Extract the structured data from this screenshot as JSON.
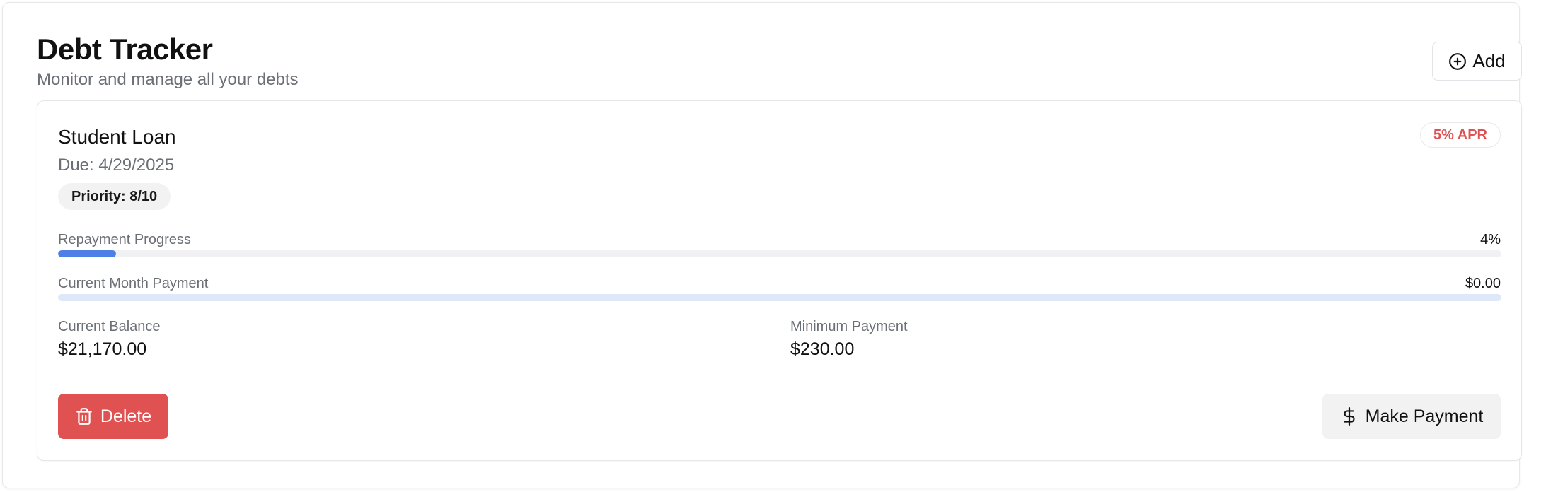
{
  "header": {
    "title": "Debt Tracker",
    "subtitle": "Monitor and manage all your debts",
    "add_label": "Add"
  },
  "debt": {
    "name": "Student Loan",
    "apr_badge": "5% APR",
    "due_date": "Due: 4/29/2025",
    "priority": "Priority: 8/10",
    "repayment_progress": {
      "label": "Repayment Progress",
      "value_text": "4%",
      "fraction": 0.04
    },
    "current_month_payment": {
      "label": "Current Month Payment",
      "value_text": "$0.00",
      "fraction": 0
    },
    "current_balance": {
      "label": "Current Balance",
      "value": "$21,170.00"
    },
    "minimum_payment": {
      "label": "Minimum Payment",
      "value": "$230.00"
    },
    "delete_label": "Delete",
    "pay_label": "Make Payment"
  },
  "colors": {
    "accent": "#4d7fe6",
    "danger": "#e05252",
    "muted_text": "#6b6f76",
    "neutral_button": "#f2f2f3"
  },
  "icons": {
    "add": "plus-circle-icon",
    "delete": "trash-icon",
    "pay": "dollar-sign-icon"
  }
}
